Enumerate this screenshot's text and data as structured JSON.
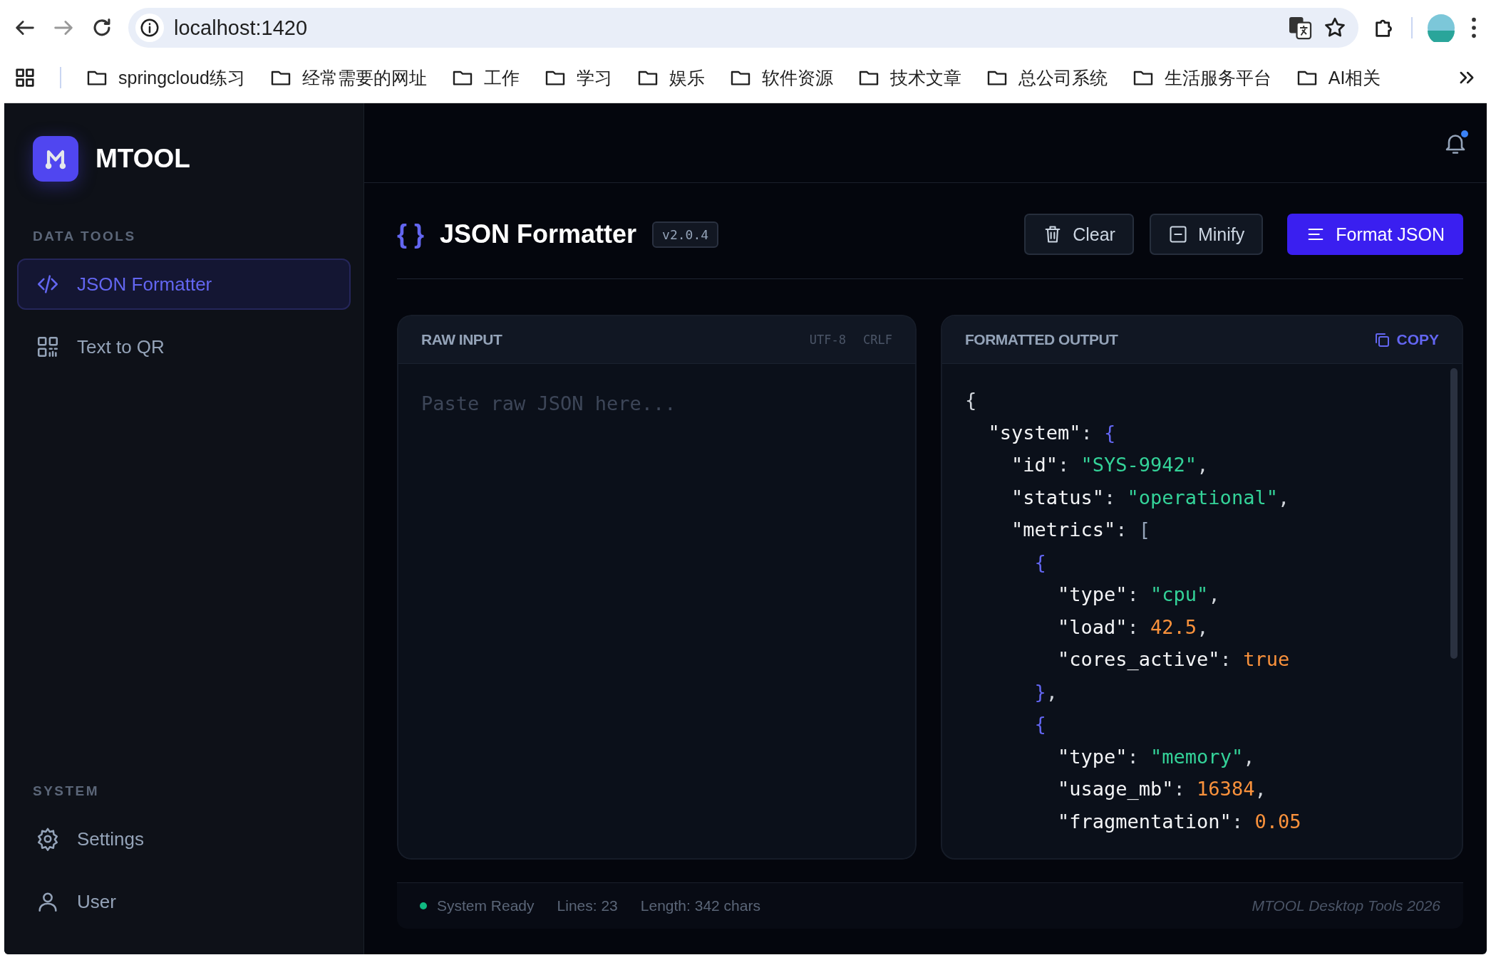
{
  "browser": {
    "url": "localhost:1420",
    "bookmarks": [
      "springcloud练习",
      "经常需要的网址",
      "工作",
      "学习",
      "娱乐",
      "软件资源",
      "技术文章",
      "总公司系统",
      "生活服务平台",
      "AI相关"
    ]
  },
  "app": {
    "name": "MTOOL",
    "has_notification": true
  },
  "sidebar": {
    "sections": [
      {
        "title": "DATA TOOLS",
        "items": [
          {
            "label": "JSON Formatter",
            "kind": "code",
            "selected": true
          },
          {
            "label": "Text to QR",
            "kind": "qr",
            "selected": false
          }
        ]
      },
      {
        "title": "SYSTEM",
        "items": [
          {
            "label": "Settings",
            "kind": "gear",
            "selected": false
          },
          {
            "label": "User",
            "kind": "user",
            "selected": false
          }
        ]
      }
    ]
  },
  "tool": {
    "title_icon": "{ }",
    "title": "JSON Formatter",
    "version": "v2.0.4",
    "buttons": [
      {
        "label": "Clear",
        "kind": "trash",
        "primary": false
      },
      {
        "label": "Minify",
        "kind": "minus",
        "primary": false
      },
      {
        "label": "Format JSON",
        "kind": "lines",
        "primary": true
      }
    ]
  },
  "input_panel": {
    "title": "RAW INPUT",
    "encoding": "UTF-8",
    "line_ending": "CRLF",
    "placeholder": "Paste raw JSON here..."
  },
  "output_panel": {
    "title": "FORMATTED OUTPUT",
    "copy_label": "COPY",
    "lines": [
      {
        "tokens": [
          {
            "kind": "punct",
            "text": "{"
          }
        ],
        "children": [
          {
            "tokens": [
              {
                "kind": "key",
                "text": "\"system\""
              },
              {
                "kind": "punct",
                "text": ": "
              },
              {
                "kind": "brace",
                "text": "{"
              }
            ],
            "children": [
              {
                "tokens": [
                  {
                    "kind": "key",
                    "text": "\"id\""
                  },
                  {
                    "kind": "punct",
                    "text": ": "
                  },
                  {
                    "kind": "string",
                    "text": "\"SYS-9942\""
                  },
                  {
                    "kind": "punct",
                    "text": ","
                  }
                ]
              },
              {
                "tokens": [
                  {
                    "kind": "key",
                    "text": "\"status\""
                  },
                  {
                    "kind": "punct",
                    "text": ": "
                  },
                  {
                    "kind": "string",
                    "text": "\"operational\""
                  },
                  {
                    "kind": "punct",
                    "text": ","
                  }
                ]
              },
              {
                "tokens": [
                  {
                    "kind": "key",
                    "text": "\"metrics\""
                  },
                  {
                    "kind": "punct",
                    "text": ": "
                  },
                  {
                    "kind": "bracket",
                    "text": "["
                  }
                ],
                "children": [
                  {
                    "tokens": [
                      {
                        "kind": "brace",
                        "text": "{"
                      }
                    ],
                    "children": [
                      {
                        "tokens": [
                          {
                            "kind": "key",
                            "text": "\"type\""
                          },
                          {
                            "kind": "punct",
                            "text": ": "
                          },
                          {
                            "kind": "string",
                            "text": "\"cpu\""
                          },
                          {
                            "kind": "punct",
                            "text": ","
                          }
                        ]
                      },
                      {
                        "tokens": [
                          {
                            "kind": "key",
                            "text": "\"load\""
                          },
                          {
                            "kind": "punct",
                            "text": ": "
                          },
                          {
                            "kind": "number",
                            "text": "42.5"
                          },
                          {
                            "kind": "punct",
                            "text": ","
                          }
                        ]
                      },
                      {
                        "tokens": [
                          {
                            "kind": "key",
                            "text": "\"cores_active\""
                          },
                          {
                            "kind": "punct",
                            "text": ": "
                          },
                          {
                            "kind": "number",
                            "text": "true"
                          }
                        ]
                      }
                    ]
                  },
                  {
                    "tokens": [
                      {
                        "kind": "brace",
                        "text": "}"
                      },
                      {
                        "kind": "punct",
                        "text": ","
                      }
                    ]
                  },
                  {
                    "tokens": [
                      {
                        "kind": "brace",
                        "text": "{"
                      }
                    ],
                    "children": [
                      {
                        "tokens": [
                          {
                            "kind": "key",
                            "text": "\"type\""
                          },
                          {
                            "kind": "punct",
                            "text": ": "
                          },
                          {
                            "kind": "string",
                            "text": "\"memory\""
                          },
                          {
                            "kind": "punct",
                            "text": ","
                          }
                        ]
                      },
                      {
                        "tokens": [
                          {
                            "kind": "key",
                            "text": "\"usage_mb\""
                          },
                          {
                            "kind": "punct",
                            "text": ": "
                          },
                          {
                            "kind": "number",
                            "text": "16384"
                          },
                          {
                            "kind": "punct",
                            "text": ","
                          }
                        ]
                      },
                      {
                        "tokens": [
                          {
                            "kind": "key",
                            "text": "\"fragmentation\""
                          },
                          {
                            "kind": "punct",
                            "text": ": "
                          },
                          {
                            "kind": "number",
                            "text": "0.05"
                          }
                        ]
                      }
                    ]
                  }
                ]
              }
            ]
          }
        ]
      }
    ]
  },
  "status_bar": {
    "status": "System Ready",
    "lines": "Lines: 23",
    "length": "Length: 342 chars",
    "credit": "MTOOL Desktop Tools 2026"
  }
}
